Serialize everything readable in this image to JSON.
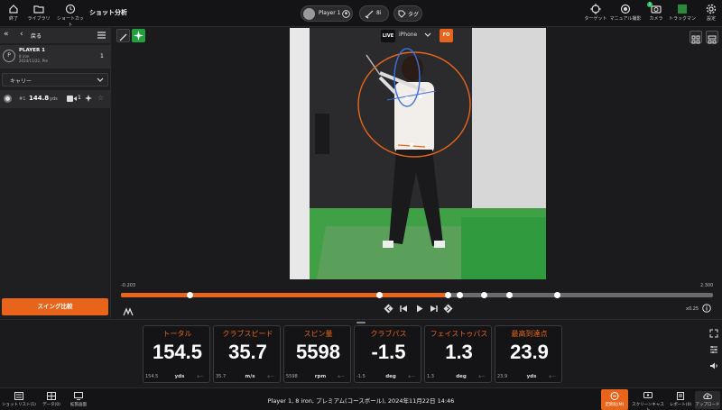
{
  "topbar": {
    "exit_label": "終了",
    "library_label": "ライブラリ",
    "shortcut_label": "ショートカット",
    "page_title": "ショット分析",
    "player_name": "Player 1",
    "club": "8i",
    "tag_label": "タグ",
    "target_label": "ターゲット",
    "manual_label": "マニュアル撮影",
    "camera_label": "カメラ",
    "camera_badge": "1",
    "trackman_label": "トラックマン",
    "settings_label": "設定"
  },
  "sidebar": {
    "back_label": "戻る",
    "player": {
      "initial": "P",
      "name": "PLAYER 1",
      "club": "8 iron",
      "date": "2024/11/22, Pre",
      "count": "1"
    },
    "carry_select": "キャリー",
    "shot": {
      "number": "#1",
      "distance": "144.8",
      "unit": "yds",
      "video_count": "1"
    },
    "compare_button": "スイング比較"
  },
  "video": {
    "live_label": "LIVE",
    "camera_select": "iPhone",
    "fo_label": "FO",
    "time_start": "-0.203",
    "time_end": "2.300",
    "progress": 0.55,
    "markers": [
      0.117,
      0.437,
      0.553,
      0.573,
      0.613,
      0.657,
      0.737
    ],
    "speed": "x0.25"
  },
  "metrics": [
    {
      "label": "トータル",
      "value": "154.5",
      "sub": "154.5",
      "unit": "yds",
      "pm": "±---"
    },
    {
      "label": "クラブスピード",
      "value": "35.7",
      "sub": "35.7",
      "unit": "m/s",
      "pm": "±---"
    },
    {
      "label": "スピン量",
      "value": "5598",
      "sub": "5598",
      "unit": "rpm",
      "pm": "±---"
    },
    {
      "label": "クラブパス",
      "value": "-1.5",
      "sub": "-1.5",
      "unit": "deg",
      "pm": "±---"
    },
    {
      "label": "フェイストゥパス",
      "value": "1.3",
      "sub": "1.3",
      "unit": "deg",
      "pm": "±---"
    },
    {
      "label": "最高到達点",
      "value": "23.9",
      "sub": "23.9",
      "unit": "yds",
      "pm": "±---"
    }
  ],
  "bottombar": {
    "shotlist_label": "ショットリスト(1)",
    "data_label": "データ(0)",
    "fullscreen_label": "拡張画面",
    "status_text": "Player 1, 8 iron, プレミアム(コースボール), 2024年11月22日 14:46",
    "analysis_label": "定期化(M)",
    "screencast_label": "スクリーンキャスト",
    "report_label": "レポート(0)",
    "upload_label": "アップロード"
  },
  "colors": {
    "accent": "#e8641a",
    "ai_green": "#22c55e"
  }
}
